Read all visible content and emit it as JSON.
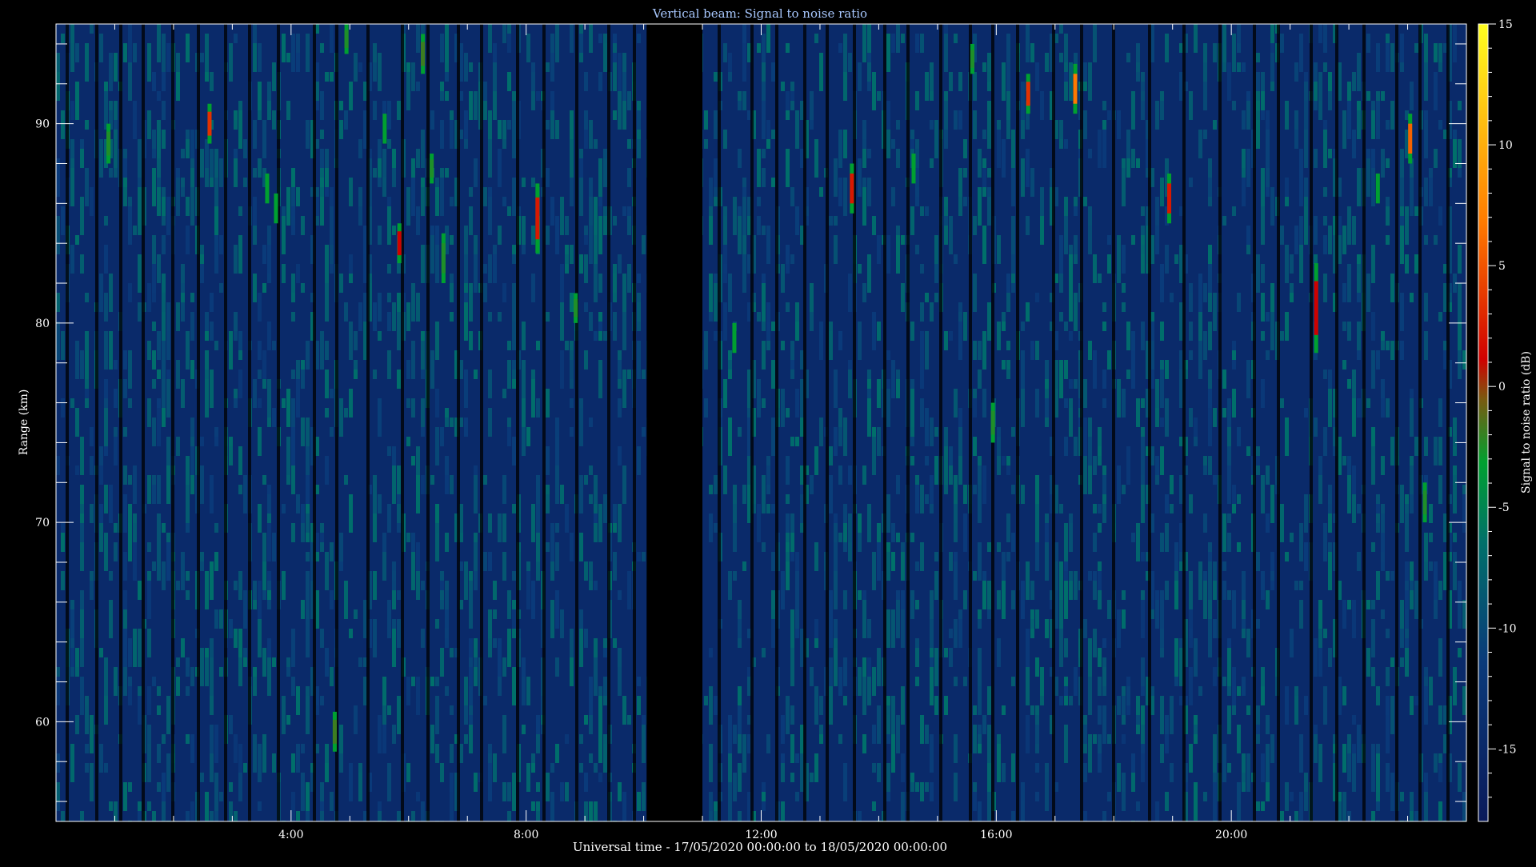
{
  "colors": {
    "background": "#000000",
    "frame": "#ffffff",
    "title": "#a8c8ff",
    "noise_base": "#0a1a5a",
    "gap": "#000000"
  },
  "chart_data": {
    "type": "heatmap",
    "title": "Vertical beam: Signal to noise ratio",
    "xlabel": "Universal time - 17/05/2020 00:00:00 to 18/05/2020 00:00:00",
    "ylabel": "Range (km)",
    "colorbar_label": "Signal to noise ratio (dB)",
    "xlim_hours": [
      0,
      24
    ],
    "ylim_km": [
      55,
      95
    ],
    "clim_db": [
      -18,
      15
    ],
    "colormap": "dark-navy → teal → green → brown → red → orange → yellow",
    "x_ticks": [
      {
        "hour": 4,
        "label": "4:00"
      },
      {
        "hour": 8,
        "label": "8:00"
      },
      {
        "hour": 12,
        "label": "12:00"
      },
      {
        "hour": 16,
        "label": "16:00"
      },
      {
        "hour": 20,
        "label": "20:00"
      }
    ],
    "y_ticks": [
      {
        "km": 60,
        "label": "60"
      },
      {
        "km": 70,
        "label": "70"
      },
      {
        "km": 80,
        "label": "80"
      },
      {
        "km": 90,
        "label": "90"
      }
    ],
    "colorbar_ticks": [
      {
        "db": 15,
        "label": "15"
      },
      {
        "db": 10,
        "label": "10"
      },
      {
        "db": 5,
        "label": "5"
      },
      {
        "db": 0,
        "label": "0"
      },
      {
        "db": -5,
        "label": "-5"
      },
      {
        "db": -10,
        "label": "-10"
      },
      {
        "db": -15,
        "label": "-15"
      }
    ],
    "data_gap_hours": [
      10.05,
      11.0
    ],
    "background_snr_db": -16,
    "echoes": [
      {
        "t": 0.9,
        "r0": 88,
        "r1": 90,
        "snr": -5
      },
      {
        "t": 2.62,
        "r0": 89,
        "r1": 91,
        "snr": 2
      },
      {
        "t": 3.6,
        "r0": 86,
        "r1": 87.5,
        "snr": -7
      },
      {
        "t": 3.75,
        "r0": 85,
        "r1": 86.5,
        "snr": -7
      },
      {
        "t": 4.75,
        "r0": 58.5,
        "r1": 60.5,
        "snr": -4
      },
      {
        "t": 4.95,
        "r0": 93.5,
        "r1": 95,
        "snr": -5
      },
      {
        "t": 5.6,
        "r0": 89,
        "r1": 90.5,
        "snr": -6
      },
      {
        "t": 5.85,
        "r0": 83,
        "r1": 85,
        "snr": 0
      },
      {
        "t": 6.25,
        "r0": 92.5,
        "r1": 94.5,
        "snr": -4
      },
      {
        "t": 6.4,
        "r0": 87,
        "r1": 88.5,
        "snr": -5
      },
      {
        "t": 6.6,
        "r0": 82,
        "r1": 84.5,
        "snr": -5
      },
      {
        "t": 8.2,
        "r0": 83.5,
        "r1": 87,
        "snr": 1
      },
      {
        "t": 8.85,
        "r0": 80,
        "r1": 81.5,
        "snr": -5
      },
      {
        "t": 11.55,
        "r0": 78.5,
        "r1": 80,
        "snr": -7
      },
      {
        "t": 13.55,
        "r0": 85.5,
        "r1": 88,
        "snr": 1
      },
      {
        "t": 14.6,
        "r0": 87,
        "r1": 88.5,
        "snr": -6
      },
      {
        "t": 15.6,
        "r0": 92.5,
        "r1": 94,
        "snr": -5
      },
      {
        "t": 15.95,
        "r0": 74,
        "r1": 76,
        "snr": -5
      },
      {
        "t": 16.55,
        "r0": 90.5,
        "r1": 92.5,
        "snr": 2
      },
      {
        "t": 17.35,
        "r0": 90.5,
        "r1": 93,
        "snr": 5
      },
      {
        "t": 18.95,
        "r0": 85,
        "r1": 87.5,
        "snr": 1
      },
      {
        "t": 21.45,
        "r0": 78.5,
        "r1": 83,
        "snr": 0
      },
      {
        "t": 22.5,
        "r0": 86,
        "r1": 87.5,
        "snr": -6
      },
      {
        "t": 23.05,
        "r0": 88,
        "r1": 90.5,
        "snr": 4
      },
      {
        "t": 23.3,
        "r0": 70,
        "r1": 72,
        "snr": -5
      }
    ]
  }
}
